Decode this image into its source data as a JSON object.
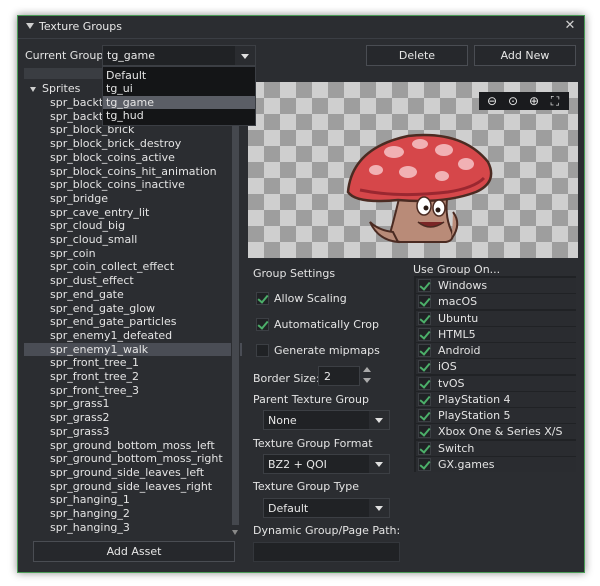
{
  "window": {
    "title": "Texture Groups"
  },
  "toolbar": {
    "current_group_label": "Current Group:",
    "current_group_value": "tg_game",
    "delete_label": "Delete",
    "add_new_label": "Add New"
  },
  "group_dropdown": {
    "options": [
      {
        "label": "Default"
      },
      {
        "label": "tg_ui"
      },
      {
        "label": "tg_game"
      },
      {
        "label": "tg_hud"
      }
    ],
    "highlighted": "tg_game"
  },
  "tree": {
    "root_label": "Sprites",
    "selected": "spr_enemy1_walk",
    "items": [
      "spr_backtrees_l",
      "spr_backtrees_r",
      "spr_block_brick",
      "spr_block_brick_destroy",
      "spr_block_coins_active",
      "spr_block_coins_hit_animation",
      "spr_block_coins_inactive",
      "spr_bridge",
      "spr_cave_entry_lit",
      "spr_cloud_big",
      "spr_cloud_small",
      "spr_coin",
      "spr_coin_collect_effect",
      "spr_dust_effect",
      "spr_end_gate",
      "spr_end_gate_glow",
      "spr_end_gate_particles",
      "spr_enemy1_defeated",
      "spr_enemy1_walk",
      "spr_front_tree_1",
      "spr_front_tree_2",
      "spr_front_tree_3",
      "spr_grass1",
      "spr_grass2",
      "spr_grass3",
      "spr_ground_bottom_moss_left",
      "spr_ground_bottom_moss_right",
      "spr_ground_side_leaves_left",
      "spr_ground_side_leaves_right",
      "spr_hanging_1",
      "spr_hanging_2",
      "spr_hanging_3"
    ],
    "add_asset_label": "Add Asset"
  },
  "preview": {
    "zoom_icons": [
      "zoom-out-icon",
      "zoom-reset-icon",
      "zoom-in-icon",
      "fullscreen-icon"
    ],
    "checker_light": "#cfcfcf",
    "checker_dark": "#9e9e9e"
  },
  "settings": {
    "heading": "Group Settings",
    "allow_scaling": {
      "label": "Allow Scaling",
      "checked": true
    },
    "automatically_crop": {
      "label": "Automatically Crop",
      "checked": true
    },
    "generate_mipmaps": {
      "label": "Generate mipmaps",
      "checked": false
    },
    "border_size_label": "Border Size:",
    "border_size_value": "2",
    "parent_group_label": "Parent Texture Group",
    "parent_group_value": "None",
    "format_label": "Texture Group Format",
    "format_value": "BZ2 + QOI",
    "type_label": "Texture Group Type",
    "type_value": "Default",
    "dynamic_path_label": "Dynamic Group/Page Path:",
    "dynamic_path_value": ""
  },
  "platforms": {
    "heading": "Use Group On...",
    "items": [
      {
        "label": "Windows",
        "checked": true
      },
      {
        "label": "macOS",
        "checked": true
      },
      {
        "label": "Ubuntu",
        "checked": true
      },
      {
        "label": "HTML5",
        "checked": true
      },
      {
        "label": "Android",
        "checked": true
      },
      {
        "label": "iOS",
        "checked": true
      },
      {
        "label": "tvOS",
        "checked": true
      },
      {
        "label": "PlayStation 4",
        "checked": true
      },
      {
        "label": "PlayStation 5",
        "checked": true
      },
      {
        "label": "Xbox One & Series X/S",
        "checked": true
      },
      {
        "label": "Switch",
        "checked": true
      },
      {
        "label": "GX.games",
        "checked": true
      }
    ]
  },
  "colors": {
    "accent_border": "#4a9b56",
    "check": "#4caf6a",
    "panel": "#2b2d31"
  }
}
